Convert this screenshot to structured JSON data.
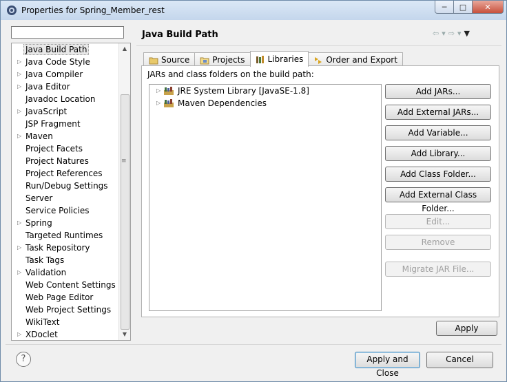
{
  "window": {
    "title": "Properties for Spring_Member_rest"
  },
  "filter": {
    "value": ""
  },
  "nav": {
    "items": [
      {
        "label": "Java Build Path",
        "expandable": false,
        "selected": true
      },
      {
        "label": "Java Code Style",
        "expandable": true
      },
      {
        "label": "Java Compiler",
        "expandable": true
      },
      {
        "label": "Java Editor",
        "expandable": true
      },
      {
        "label": "Javadoc Location",
        "expandable": false
      },
      {
        "label": "JavaScript",
        "expandable": true
      },
      {
        "label": "JSP Fragment",
        "expandable": false
      },
      {
        "label": "Maven",
        "expandable": true
      },
      {
        "label": "Project Facets",
        "expandable": false
      },
      {
        "label": "Project Natures",
        "expandable": false
      },
      {
        "label": "Project References",
        "expandable": false
      },
      {
        "label": "Run/Debug Settings",
        "expandable": false
      },
      {
        "label": "Server",
        "expandable": false
      },
      {
        "label": "Service Policies",
        "expandable": false
      },
      {
        "label": "Spring",
        "expandable": true
      },
      {
        "label": "Targeted Runtimes",
        "expandable": false
      },
      {
        "label": "Task Repository",
        "expandable": true
      },
      {
        "label": "Task Tags",
        "expandable": false
      },
      {
        "label": "Validation",
        "expandable": true
      },
      {
        "label": "Web Content Settings",
        "expandable": false
      },
      {
        "label": "Web Page Editor",
        "expandable": false
      },
      {
        "label": "Web Project Settings",
        "expandable": false
      },
      {
        "label": "WikiText",
        "expandable": false
      },
      {
        "label": "XDoclet",
        "expandable": true
      }
    ]
  },
  "page": {
    "title": "Java Build Path"
  },
  "tabs": [
    {
      "label": "Source",
      "icon": "source-folder-icon",
      "active": false
    },
    {
      "label": "Projects",
      "icon": "projects-folder-icon",
      "active": false
    },
    {
      "label": "Libraries",
      "icon": "libraries-icon",
      "active": true
    },
    {
      "label": "Order and Export",
      "icon": "order-export-icon",
      "active": false
    }
  ],
  "libraries": {
    "label": "JARs and class folders on the build path:",
    "items": [
      {
        "label": "JRE System Library [JavaSE-1.8]",
        "icon": "library-icon"
      },
      {
        "label": "Maven Dependencies",
        "icon": "library-icon"
      }
    ]
  },
  "buttons": {
    "add_jars": "Add JARs...",
    "add_external_jars": "Add External JARs...",
    "add_variable": "Add Variable...",
    "add_library": "Add Library...",
    "add_class_folder": "Add Class Folder...",
    "add_external_class_folder": "Add External Class Folder...",
    "edit": "Edit...",
    "remove": "Remove",
    "migrate_jar": "Migrate JAR File...",
    "apply": "Apply",
    "apply_and_close": "Apply and Close",
    "cancel": "Cancel"
  },
  "colors": {
    "accent": "#3c7fb1",
    "titlebar": "#c4d6ec"
  }
}
